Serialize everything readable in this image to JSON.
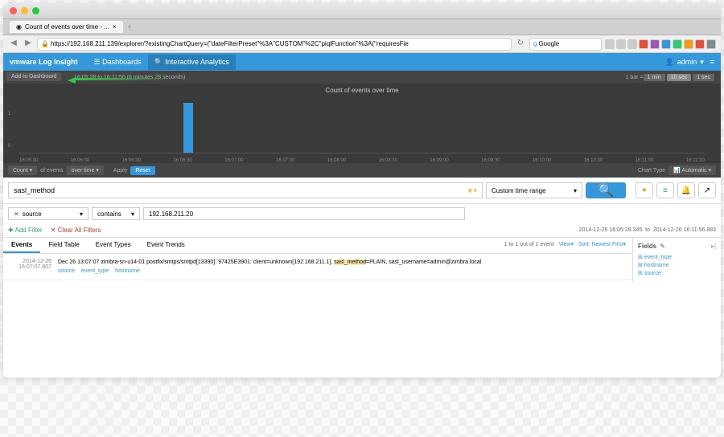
{
  "browser": {
    "tab_title": "Count of events over time - ...",
    "url": "https://192.168.211.139/explorer/?existingChartQuery=(\"dateFilterPreset\"%3A\"CUSTOM\"%2C\"piqlFunction\"%3A(\"requiresFie",
    "search_engine": "Google"
  },
  "header": {
    "brand": "vmware Log Insight",
    "dashboards": "Dashboards",
    "interactive": "Interactive Analytics",
    "user": "admin"
  },
  "chart": {
    "add_dashboard": "Add to Dashboard",
    "time_from": "16:05:28",
    "time_to": "16:11:56",
    "duration": "(6 minutes 28 seconds)",
    "bar_label": "1 bar =",
    "opt1": "1 min",
    "opt2": "10 sec",
    "opt3": "1 sec",
    "title": "Count of events over time",
    "chart_type_label": "Chart Type",
    "chart_type": "Automatic"
  },
  "chart_data": {
    "type": "bar",
    "title": "Count of events over time",
    "ylabel": "",
    "ylim": [
      0,
      1.5
    ],
    "categories": [
      "16:05:30",
      "16:06:00",
      "16:06:30",
      "16:06:30",
      "16:07:00",
      "16:07:30",
      "16:08:00",
      "16:08:30",
      "16:09:00",
      "16:09:30",
      "16:10:00",
      "16:10:30",
      "16:11:00",
      "16:11:30"
    ],
    "values": [
      0,
      0,
      0,
      0,
      1,
      0,
      0,
      0,
      0,
      0,
      0,
      0,
      0,
      0
    ]
  },
  "controls": {
    "count": "Count",
    "of_events": "of events",
    "over_time": "over time",
    "apply": "Apply",
    "reset": "Reset"
  },
  "query": {
    "text": "sasl_method",
    "time_range": "Custom time range"
  },
  "filters": {
    "field": "source",
    "op": "contains",
    "val": "192.168.211.20",
    "add": "Add Filter",
    "clear": "Clear All Filters",
    "time_from": "2014-12-26 16:05:28.345",
    "time_to": "2014-12-26 16:11:56.883"
  },
  "tabs": {
    "events": "Events",
    "field_table": "Field Table",
    "event_types": "Event Types",
    "event_trends": "Event Trends",
    "pager": "1 to 1 out of 1 event",
    "view": "View",
    "sort": "Sort: Newest First"
  },
  "event": {
    "ts1": "2014-12-26",
    "ts2": "16:07:07.807",
    "msg_pre": "Dec 26 13:07:07 zimbra-sn-u14-01 postfix/smtps/smtpd[13390]: 97425E3901: client=unknown[192.168.211.1], ",
    "msg_hl": "sasl_method",
    "msg_post": "=PLAIN, sasl_username=admin@zimbra.local",
    "tag1": "source",
    "tag2": "event_type",
    "tag3": "hostname"
  },
  "fields": {
    "title": "Fields",
    "f1": "event_type",
    "f2": "hostname",
    "f3": "source"
  }
}
